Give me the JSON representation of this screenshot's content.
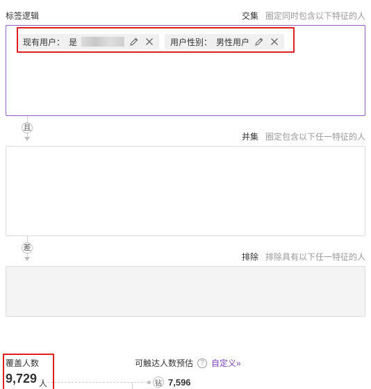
{
  "logic": {
    "title": "标签逻辑"
  },
  "intersect": {
    "name": "交集",
    "desc": "圈定同时包含以下特征的人"
  },
  "tags": [
    {
      "key": "现有用户：",
      "value": "是"
    },
    {
      "key": "用户性别：",
      "value": "男性用户"
    }
  ],
  "op_and": "且",
  "union": {
    "name": "并集",
    "desc": "圈定包含以下任一特征的人"
  },
  "op_diff": "差",
  "exclude": {
    "name": "排除",
    "desc": "排除具有以下任一特征的人"
  },
  "coverage": {
    "label": "覆盖人数",
    "value": "9,729",
    "unit": "人"
  },
  "reach": {
    "label": "可触达人数预估",
    "custom": "自定义",
    "custom_arrow": "»"
  },
  "channel": {
    "icon_char": "钻",
    "value": "7,596"
  },
  "colors": {
    "accent": "#7b3fbf",
    "highlight": "#e01e1e"
  },
  "icons": {
    "edit": "pencil-icon",
    "remove": "close-icon",
    "help": "question-icon"
  }
}
